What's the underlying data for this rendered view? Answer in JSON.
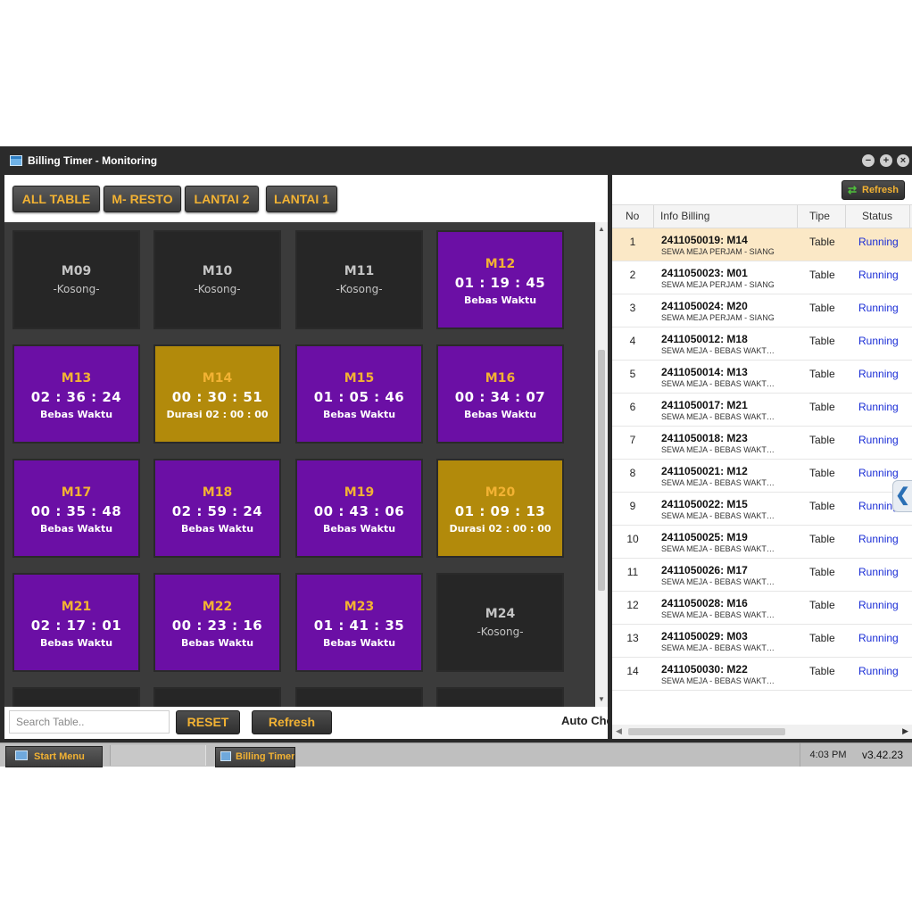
{
  "window": {
    "title": "Billing Timer - Monitoring",
    "controls": [
      "−",
      "+",
      "×"
    ]
  },
  "categories": [
    "ALL TABLE",
    "M- RESTO",
    "LANTAI 2",
    "LANTAI 1"
  ],
  "tiles": [
    {
      "code": "M09",
      "state": "empty",
      "sub": "-Kosong-"
    },
    {
      "code": "M10",
      "state": "empty",
      "sub": "-Kosong-"
    },
    {
      "code": "M11",
      "state": "empty",
      "sub": "-Kosong-"
    },
    {
      "code": "M12",
      "state": "run",
      "timer": "01 : 19 : 45",
      "mode": "Bebas Waktu"
    },
    {
      "code": "M13",
      "state": "run",
      "timer": "02 : 36 : 24",
      "mode": "Bebas Waktu"
    },
    {
      "code": "M14",
      "state": "dur",
      "timer": "00 : 30 : 51",
      "mode": "Durasi 02 : 00 : 00"
    },
    {
      "code": "M15",
      "state": "run",
      "timer": "01 : 05 : 46",
      "mode": "Bebas Waktu"
    },
    {
      "code": "M16",
      "state": "run",
      "timer": "00 : 34 : 07",
      "mode": "Bebas Waktu"
    },
    {
      "code": "M17",
      "state": "run",
      "timer": "00 : 35 : 48",
      "mode": "Bebas Waktu"
    },
    {
      "code": "M18",
      "state": "run",
      "timer": "02 : 59 : 24",
      "mode": "Bebas Waktu"
    },
    {
      "code": "M19",
      "state": "run",
      "timer": "00 : 43 : 06",
      "mode": "Bebas Waktu"
    },
    {
      "code": "M20",
      "state": "dur",
      "timer": "01 : 09 : 13",
      "mode": "Durasi 02 : 00 : 00"
    },
    {
      "code": "M21",
      "state": "run",
      "timer": "02 : 17 : 01",
      "mode": "Bebas Waktu"
    },
    {
      "code": "M22",
      "state": "run",
      "timer": "00 : 23 : 16",
      "mode": "Bebas Waktu"
    },
    {
      "code": "M23",
      "state": "run",
      "timer": "01 : 41 : 35",
      "mode": "Bebas Waktu"
    },
    {
      "code": "M24",
      "state": "empty",
      "sub": "-Kosong-"
    },
    {
      "code": "",
      "state": "empty",
      "sub": ""
    },
    {
      "code": "",
      "state": "empty",
      "sub": ""
    },
    {
      "code": "",
      "state": "empty",
      "sub": ""
    },
    {
      "code": "",
      "state": "empty",
      "sub": ""
    }
  ],
  "search": {
    "placeholder": "Search Table.."
  },
  "buttons": {
    "reset": "RESET",
    "refresh": "Refresh"
  },
  "auto_check_label": "Auto Check",
  "billing": {
    "refresh_label": "Refresh",
    "columns": {
      "no": "No",
      "info": "Info Billing",
      "tipe": "Tipe",
      "status": "Status"
    },
    "rows": [
      {
        "no": "1",
        "inv": "2411050019: M14",
        "desc": "SEWA MEJA PERJAM - SIANG",
        "tipe": "Table",
        "status": "Running"
      },
      {
        "no": "2",
        "inv": "2411050023: M01",
        "desc": "SEWA MEJA PERJAM - SIANG",
        "tipe": "Table",
        "status": "Running"
      },
      {
        "no": "3",
        "inv": "2411050024: M20",
        "desc": "SEWA MEJA PERJAM - SIANG",
        "tipe": "Table",
        "status": "Running"
      },
      {
        "no": "4",
        "inv": "2411050012: M18",
        "desc": "SEWA MEJA - BEBAS WAKT…",
        "tipe": "Table",
        "status": "Running"
      },
      {
        "no": "5",
        "inv": "2411050014: M13",
        "desc": "SEWA MEJA - BEBAS WAKT…",
        "tipe": "Table",
        "status": "Running"
      },
      {
        "no": "6",
        "inv": "2411050017: M21",
        "desc": "SEWA MEJA - BEBAS WAKT…",
        "tipe": "Table",
        "status": "Running"
      },
      {
        "no": "7",
        "inv": "2411050018: M23",
        "desc": "SEWA MEJA - BEBAS WAKT…",
        "tipe": "Table",
        "status": "Running"
      },
      {
        "no": "8",
        "inv": "2411050021: M12",
        "desc": "SEWA MEJA - BEBAS WAKT…",
        "tipe": "Table",
        "status": "Running"
      },
      {
        "no": "9",
        "inv": "2411050022: M15",
        "desc": "SEWA MEJA - BEBAS WAKT…",
        "tipe": "Table",
        "status": "Running"
      },
      {
        "no": "10",
        "inv": "2411050025: M19",
        "desc": "SEWA MEJA - BEBAS WAKT…",
        "tipe": "Table",
        "status": "Running"
      },
      {
        "no": "11",
        "inv": "2411050026: M17",
        "desc": "SEWA MEJA - BEBAS WAKT…",
        "tipe": "Table",
        "status": "Running"
      },
      {
        "no": "12",
        "inv": "2411050028: M16",
        "desc": "SEWA MEJA - BEBAS WAKT…",
        "tipe": "Table",
        "status": "Running"
      },
      {
        "no": "13",
        "inv": "2411050029: M03",
        "desc": "SEWA MEJA - BEBAS WAKT…",
        "tipe": "Table",
        "status": "Running"
      },
      {
        "no": "14",
        "inv": "2411050030: M22",
        "desc": "SEWA MEJA - BEBAS WAKT…",
        "tipe": "Table",
        "status": "Running"
      }
    ]
  },
  "taskbar": {
    "start_label": "Start Menu",
    "app_label": "Billing Timer",
    "clock": "4:03 PM",
    "version": "v3.42.23"
  },
  "icons": {
    "window": "window-icon",
    "refresh": "refresh-icon",
    "collapse": "chevron-left-icon",
    "start": "monitor-icon"
  },
  "colors": {
    "accent": "#f2b233",
    "running_tile": "#6b0fa5",
    "duration_tile": "#b28a0b",
    "empty_tile": "#262626",
    "selected_row": "#fbe8c6",
    "status_text": "#1a2dd6"
  }
}
